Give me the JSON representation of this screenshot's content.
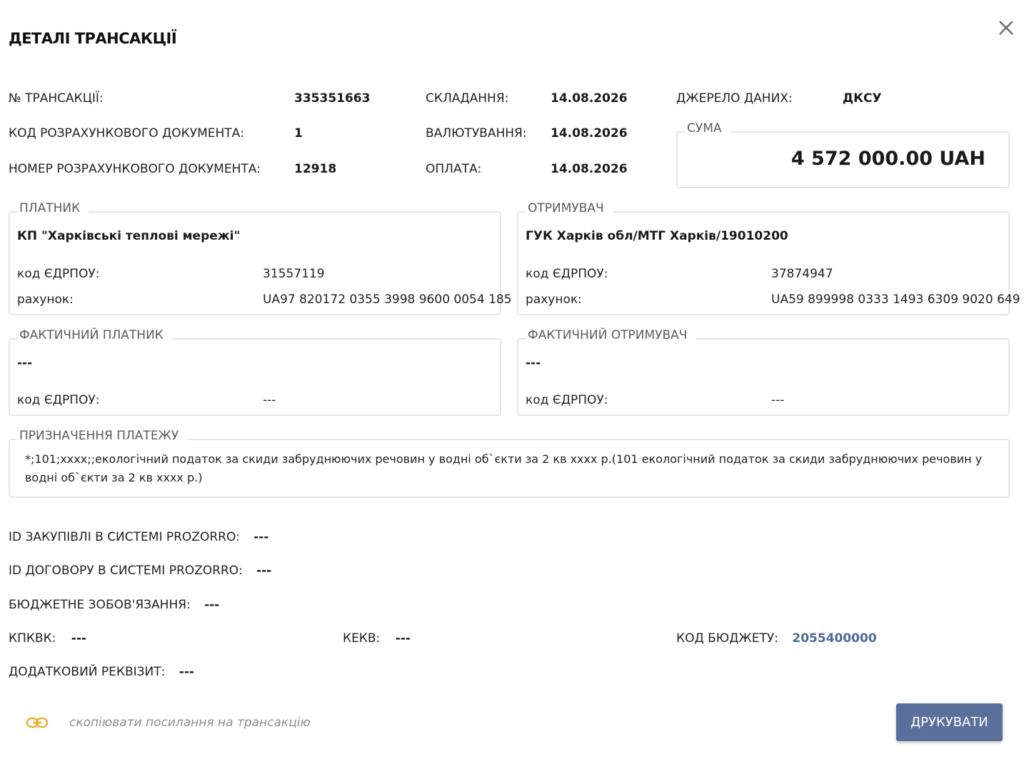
{
  "title": "ДЕТАЛІ ТРАНСАКЦІЇ",
  "header": {
    "transaction_no_label": "№ ТРАНСАКЦІЇ:",
    "transaction_no": "335351663",
    "doc_code_label": "КОД РОЗРАХУНКОВОГО ДОКУМЕНТА:",
    "doc_code": "1",
    "doc_number_label": "НОМЕР РОЗРАХУНКОВОГО ДОКУМЕНТА:",
    "doc_number": "12918",
    "compiled_label": "СКЛАДАННЯ:",
    "compiled": "14.08.2026",
    "valuation_label": "ВАЛЮТУВАННЯ:",
    "valuation": "14.08.2026",
    "payment_label": "ОПЛАТА:",
    "payment": "14.08.2026",
    "source_label": "ДЖЕРЕЛО ДАНИХ:",
    "source": "ДКСУ",
    "sum_label": "СУМА",
    "sum": "4 572 000.00 UAH"
  },
  "payer": {
    "legend": "ПЛАТНИК",
    "name": "КП \"Харківські теплові мережі\"",
    "edrpou_label": "код ЄДРПОУ:",
    "edrpou": "31557119",
    "account_label": "рахунок:",
    "account": "UA97 820172 0355 3998 9600 0054 185"
  },
  "receiver": {
    "legend": "ОТРИМУВАЧ",
    "name": "ГУК Харків обл/МТГ Харків/19010200",
    "edrpou_label": "код ЄДРПОУ:",
    "edrpou": "37874947",
    "account_label": "рахунок:",
    "account": "UA59 899998 0333 1493 6309 9020 649"
  },
  "actual_payer": {
    "legend": "ФАКТИЧНИЙ ПЛАТНИК",
    "name": "---",
    "edrpou_label": "код ЄДРПОУ:",
    "edrpou": "---"
  },
  "actual_receiver": {
    "legend": "ФАКТИЧНИЙ ОТРИМУВАЧ",
    "name": "---",
    "edrpou_label": "код ЄДРПОУ:",
    "edrpou": "---"
  },
  "purpose": {
    "legend": "ПРИЗНАЧЕННЯ ПЛАТЕЖУ",
    "text": "*;101;xxxx;;екологічний податок за скиди забруднюючих речовин у водні об`єкти за 2 кв xxxx р.(101 екологічний податок за скиди забруднюючих речовин у водні об`єкти за 2 кв xxxx р.)"
  },
  "extra": {
    "prozorro_purchase_label": "ID ЗАКУПІВЛІ В СИСТЕМІ PROZORRO:",
    "prozorro_purchase": "---",
    "prozorro_contract_label": "ID ДОГОВОРУ В СИСТЕМІ PROZORRO:",
    "prozorro_contract": "---",
    "budget_obligation_label": "БЮДЖЕТНЕ ЗОБОВ'ЯЗАННЯ:",
    "budget_obligation": "---",
    "kpkvk_label": "КПКВК:",
    "kpkvk": "---",
    "kekv_label": "КЕКВ:",
    "kekv": "---",
    "budget_code_label": "КОД БЮДЖЕТУ:",
    "budget_code": "2055400000",
    "additional_label": "ДОДАТКОВИЙ РЕКВІЗИТ:",
    "additional": "---"
  },
  "footer": {
    "copy_link": "скопіювати посилання на трансакцію",
    "print": "ДРУКУВАТИ"
  },
  "colors": {
    "accent": "#5b6f9c",
    "link": "#4e6896",
    "link_icon": "#e7b339",
    "border": "#e4e6ee"
  }
}
